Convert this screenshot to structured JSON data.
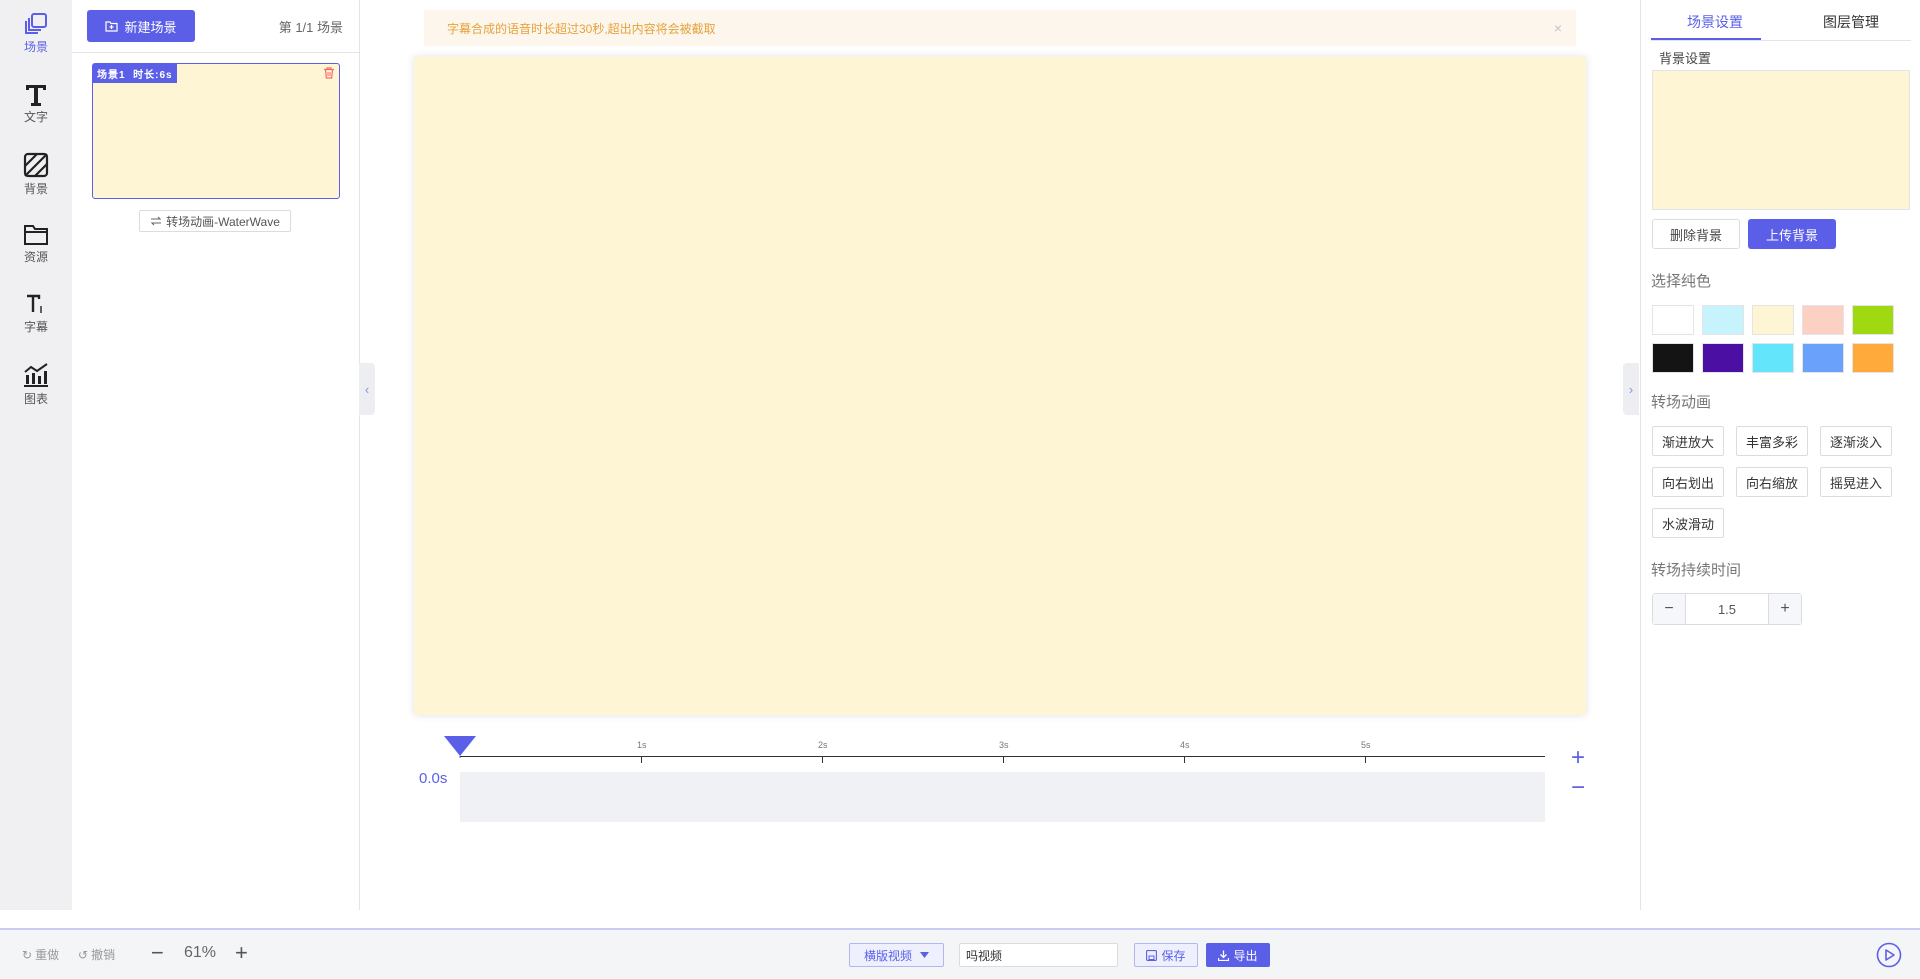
{
  "rail": {
    "items": [
      {
        "label": "场景",
        "icon": "layers-icon"
      },
      {
        "label": "文字",
        "icon": "text-icon"
      },
      {
        "label": "背景",
        "icon": "background-icon"
      },
      {
        "label": "资源",
        "icon": "folder-icon"
      },
      {
        "label": "字幕",
        "icon": "subtitle-icon"
      },
      {
        "label": "图表",
        "icon": "chart-icon"
      }
    ]
  },
  "scenes": {
    "new_button": "新建场景",
    "count": "第 1/1 场景",
    "card_tag": "场景1  时长:6s",
    "transition": "转场动画-WaterWave"
  },
  "notice": {
    "text": "字幕合成的语音时长超过30秒,超出内容将会被截取",
    "close": "×"
  },
  "timeline": {
    "readout": "0.0s",
    "ticks": [
      "1s",
      "2s",
      "3s",
      "4s",
      "5s"
    ],
    "plus": "+",
    "minus": "−"
  },
  "right": {
    "tabs": [
      "场景设置",
      "图层管理"
    ],
    "bg_label": "背景设置",
    "delete_bg": "删除背景",
    "upload_bg": "上传背景",
    "solid_label": "选择纯色",
    "swatches": [
      "#ffffff",
      "#c6f3fc",
      "#fef5d4",
      "#fdd0c4",
      "#a0d911",
      "#141414",
      "#4b0fa3",
      "#63e6fb",
      "#6aa1fb",
      "#ffaa3b"
    ],
    "anim_label": "转场动画",
    "anims": [
      "渐进放大",
      "丰富多彩",
      "逐渐淡入",
      "向右划出",
      "向右缩放",
      "摇晃进入",
      "水波滑动"
    ],
    "duration_label": "转场持续时间",
    "duration_value": "1.5",
    "dec": "−",
    "inc": "+"
  },
  "bottom": {
    "redo": "重做",
    "undo": "撤销",
    "zoom_minus": "−",
    "zoom": "61%",
    "zoom_plus": "+",
    "orientation": "横版视频",
    "video_name": "吗视频",
    "save": "保存",
    "export": "导出"
  },
  "colors": {
    "accent": "#5b5fe8",
    "canvas": "#fef5d4",
    "warning": "#e6a23c"
  }
}
